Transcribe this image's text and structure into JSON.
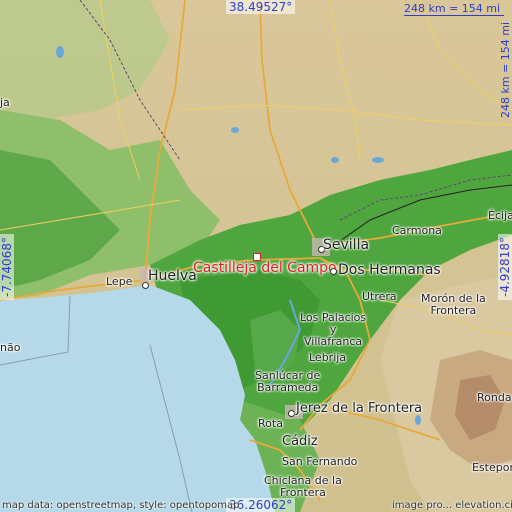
{
  "map": {
    "coords": {
      "north": "38.49527°",
      "south": "36.26062°",
      "west": "-7.74068°",
      "east": "-4.92818°"
    },
    "scale": {
      "horizontal": "248 km = 154 mi",
      "vertical": "248 km = 154 mi"
    },
    "focus_place": "Castilleja del Campo",
    "places": {
      "sevilla": "Sevilla",
      "huelva": "Huelva",
      "dos_hermanas": "Dos Hermanas",
      "lepe": "Lepe",
      "carmona": "Carmona",
      "ecija": "Écija",
      "utrera": "Utrera",
      "moron": "Morón de la\nFrontera",
      "los_palacios": "Los Palacios\ny\nVillafranca",
      "lebrija": "Lebrija",
      "sanlucar": "Sanlúcar de\nBarrameda",
      "jerez": "Jerez de la Frontera",
      "rota": "Rota",
      "cadiz": "Cádiz",
      "san_fernando": "San Fernando",
      "chiclana": "Chiclana de la\nFrontera",
      "ronda": "Ronda",
      "estepona": "Estepona",
      "west_edge_1": "ja",
      "west_edge_2": "não"
    },
    "attribution_left": "map data: openstreetmap, style: opentopomap",
    "attribution_right": "image pro... elevation.city"
  }
}
